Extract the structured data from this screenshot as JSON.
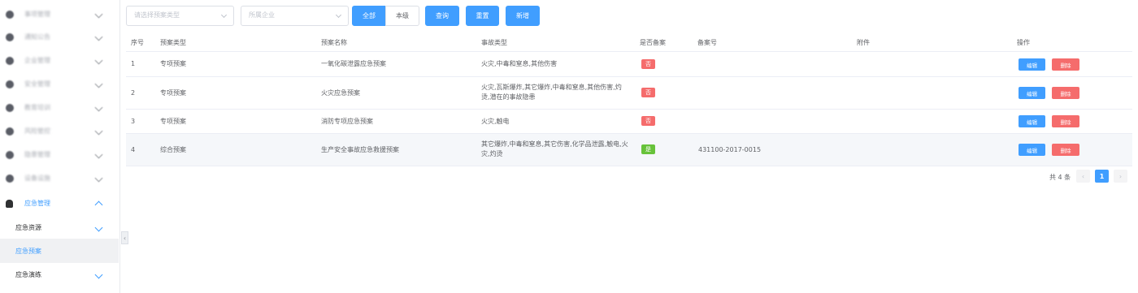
{
  "sidebar": {
    "blurred_items": [
      {
        "label": "事项管理",
        "icon": "grid-icon"
      },
      {
        "label": "通知公告",
        "icon": "bell-icon"
      },
      {
        "label": "企业管理",
        "icon": "building-icon"
      },
      {
        "label": "安全管理",
        "icon": "shield-icon"
      },
      {
        "label": "教育培训",
        "icon": "book-icon"
      },
      {
        "label": "风险管控",
        "icon": "warning-icon"
      },
      {
        "label": "隐患管理",
        "icon": "hazard-icon"
      },
      {
        "label": "设备设施",
        "icon": "tool-icon"
      }
    ],
    "open_item": {
      "label": "应急管理",
      "icon": "user-shield-icon"
    },
    "sub_items": [
      {
        "label": "应急资源",
        "has_children": true,
        "active": false
      },
      {
        "label": "应急预案",
        "has_children": false,
        "active": true
      },
      {
        "label": "应急演练",
        "has_children": true,
        "active": false
      }
    ],
    "collapse_glyph": "‹"
  },
  "toolbar": {
    "type_placeholder": "请选择预案类型",
    "company_placeholder": "所属企业",
    "all_label": "全部",
    "own_level_label": "本级",
    "query_label": "查询",
    "reset_label": "重置",
    "add_label": "新增"
  },
  "table": {
    "headers": {
      "index": "序号",
      "plan_type": "预案类型",
      "plan_name": "预案名称",
      "accident_type": "事故类型",
      "filed": "是否备案",
      "filing_no": "备案号",
      "attachment": "附件",
      "actions": "操作"
    },
    "rows": [
      {
        "index": "1",
        "plan_type": "专项预案",
        "plan_name": "一氧化碳泄露应急预案",
        "accident_lines": [
          "火灾,中毒和窒息,其他伤害"
        ],
        "filed": "否",
        "filed_status": "no",
        "filing_no": "",
        "attachment": ""
      },
      {
        "index": "2",
        "plan_type": "专项预案",
        "plan_name": "火灾应急预案",
        "accident_lines": [
          "火灾,瓦斯爆炸,其它爆炸,中毒和窒息,其他伤害,灼",
          "烫,潜在的事故隐患"
        ],
        "filed": "否",
        "filed_status": "no",
        "filing_no": "",
        "attachment": ""
      },
      {
        "index": "3",
        "plan_type": "专项预案",
        "plan_name": "消防专项应急预案",
        "accident_lines": [
          "火灾,触电"
        ],
        "filed": "否",
        "filed_status": "no",
        "filing_no": "",
        "attachment": ""
      },
      {
        "index": "4",
        "plan_type": "综合预案",
        "plan_name": "生产安全事故应急救援预案",
        "accident_lines": [
          "其它爆炸,中毒和窒息,其它伤害,化学品泄露,触电,火",
          "灾,灼烫"
        ],
        "filed": "是",
        "filed_status": "yes",
        "filing_no": "431100-2017-0015",
        "attachment": ""
      }
    ],
    "edit_label": "编辑",
    "delete_label": "删除"
  },
  "pagination": {
    "total_text": "共 4 条",
    "current_page": "1",
    "prev_glyph": "‹",
    "next_glyph": "›"
  },
  "colors": {
    "primary": "#409eff",
    "danger": "#f56c6c",
    "success": "#67c23a"
  }
}
